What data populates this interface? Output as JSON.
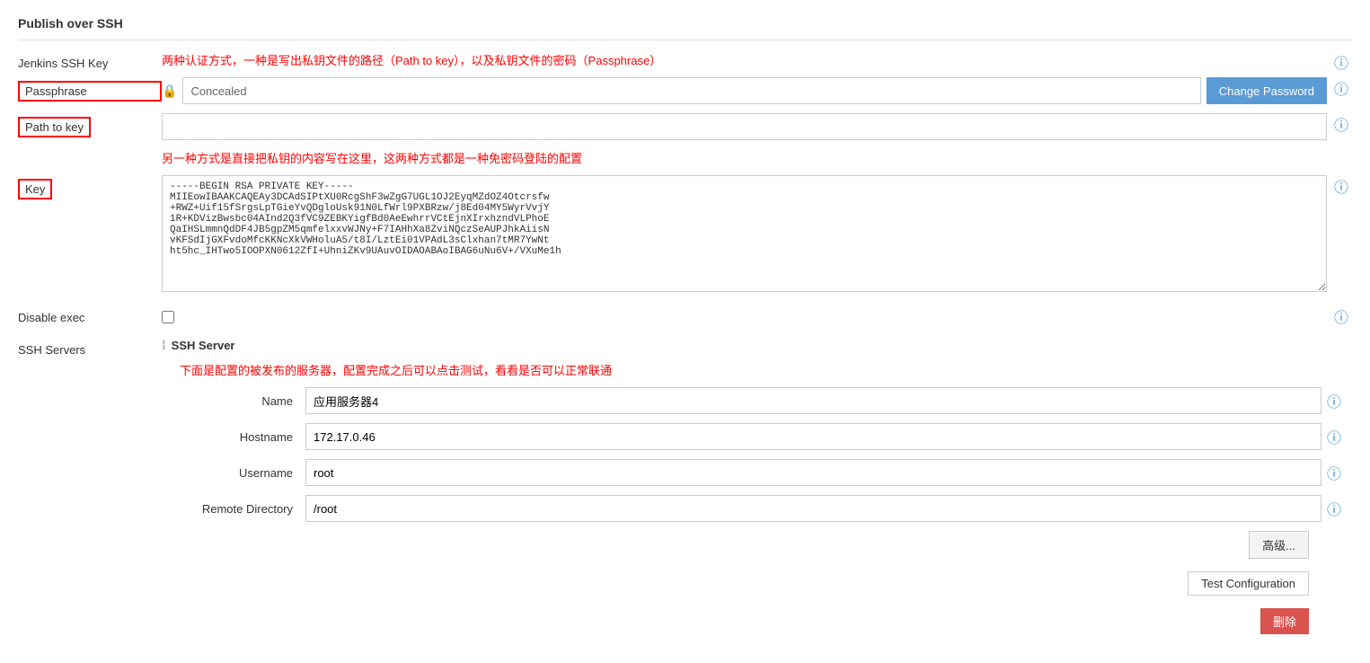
{
  "page": {
    "title": "Publish over SSH"
  },
  "sections": {
    "jenkins_ssh_key": "Jenkins SSH Key",
    "annotation1": "两种认证方式，一种是写出私钥文件的路径（Path to key），以及私钥文件的密码（Passphrase）",
    "passphrase_label": "Passphrase",
    "path_to_key_label": "Path to key",
    "key_label": "Key",
    "annotation2": "另一种方式是直接把私钥的内容写在这里，这两种方式都是一种免密码登陆的配置",
    "concealed_text": "Concealed",
    "change_password_label": "Change Password",
    "key_content": "-----BEGIN RSA PRIVATE KEY-----\nMIIEowIBAAKCAQEAy3DCAdSIPtXU0RcgShF3wZgG7UGL1OJ2EyqMZdOZ4Otcrsfw\n+RWZ+Uif15fSrgsLpTGieYvQDgloUsk91N0LfWrl9PXBRzw/j8Ed04MY5WyrVvjY\n1R+KDVizBwsbc04AInd2Q3fVC9ZEBKYigfBd0AeEwhrrVCtEjnXIrxhzndVLPhoE\nQaIHSLmmnQdDF4JB5gpZM5qmfelxxvWJNy+F7IAHhXa8ZviNQczSeAUPJhkAiisN\nvKFSdIjGXFvdoMfcKKNcXkVWHoluA5/t8I/LztEi01VPAdL3sClxhan7tMR7YwNt\nht5hc_IHTwo5IOOPXN0612ZfI+UhniZKv9UAuvOIDAOABAoIBAG6uNu6V+/VXuMe1h",
    "disable_exec_label": "Disable exec",
    "ssh_servers_label": "SSH Servers",
    "ssh_server_title": "SSH Server",
    "name_label": "Name",
    "name_value": "应用服务器4",
    "hostname_label": "Hostname",
    "hostname_value": "172.17.0.46",
    "username_label": "Username",
    "username_value": "root",
    "remote_directory_label": "Remote Directory",
    "remote_directory_value": "/root",
    "annotation3": "下面是配置的被发布的服务器，配置完成之后可以点击测试，看看是否可以正常联通",
    "advanced_label": "高级...",
    "test_config_label": "Test Configuration",
    "delete_label": "删除"
  },
  "icons": {
    "lock": "🔒",
    "help": "?",
    "drag": "⠿"
  }
}
